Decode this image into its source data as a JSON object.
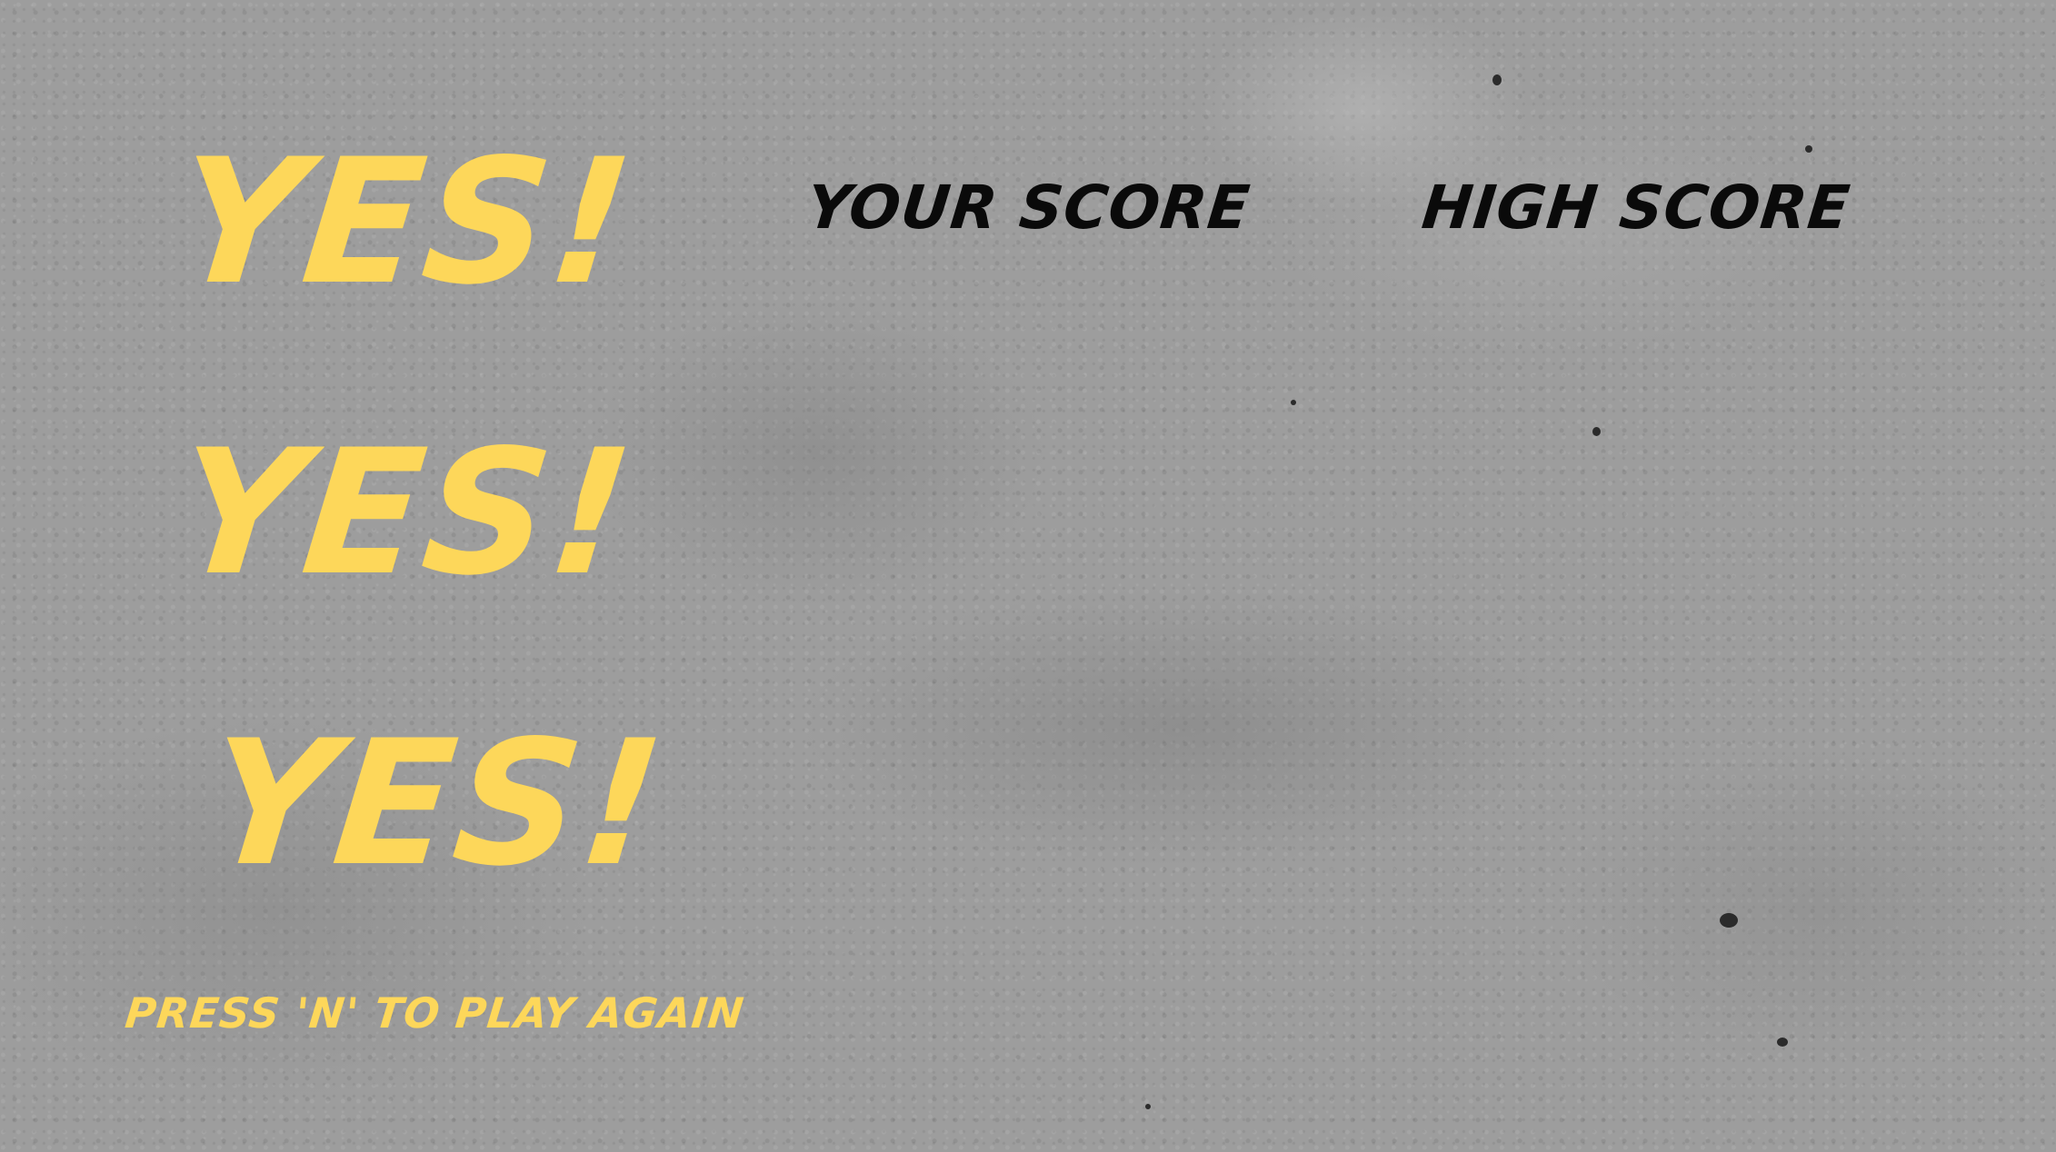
{
  "game": {
    "result_lines": [
      "YES!",
      "YES!",
      "YES!"
    ],
    "play_again_prompt": "PRESS 'N' TO PLAY AGAIN",
    "your_score_label": "YOUR SCORE",
    "high_score_label": "HIGH SCORE",
    "your_score_value": "",
    "high_score_value": ""
  },
  "colors": {
    "accent_yellow": "#fdd75a",
    "label_black": "#0a0a0a",
    "background_gray": "#9d9d9d"
  }
}
